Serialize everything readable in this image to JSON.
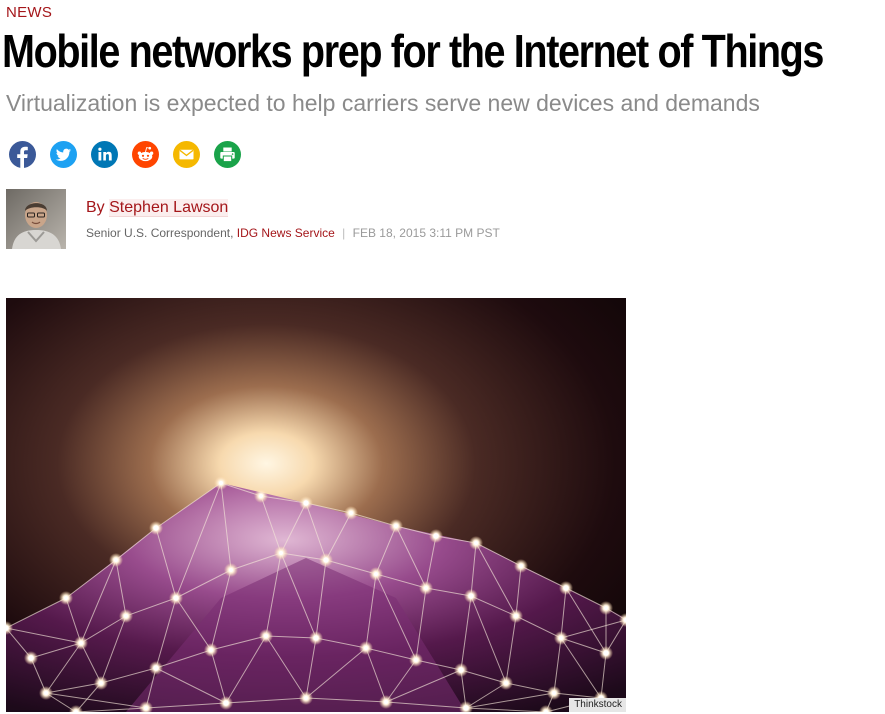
{
  "article": {
    "kicker": "NEWS",
    "headline": "Mobile networks prep for the Internet of Things",
    "dek": "Virtualization is expected to help carriers serve new devices and demands"
  },
  "share": {
    "icons": [
      {
        "name": "facebook-icon",
        "color": "#3b5998"
      },
      {
        "name": "twitter-icon",
        "color": "#1da1f2"
      },
      {
        "name": "linkedin-icon",
        "color": "#0077b5"
      },
      {
        "name": "reddit-icon",
        "color": "#ff4500"
      },
      {
        "name": "email-icon",
        "color": "#f5b800"
      },
      {
        "name": "print-icon",
        "color": "#1aa34a"
      }
    ]
  },
  "byline": {
    "by": "By",
    "author": "Stephen Lawson",
    "title": "Senior U.S. Correspondent,",
    "organization": "IDG News Service",
    "separator": "|",
    "date": "FEB 18, 2015 3:11 PM PST"
  },
  "hero": {
    "credit": "Thinkstock"
  },
  "colors": {
    "accent": "#a4161a",
    "dek": "#8a8a8a",
    "meta": "#666666"
  }
}
